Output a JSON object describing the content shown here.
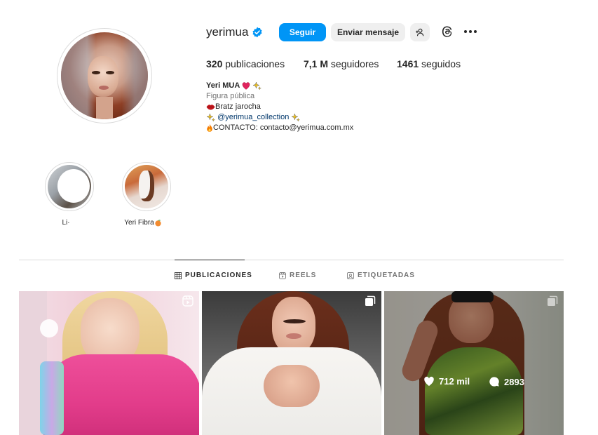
{
  "profile": {
    "username": "yerimua",
    "follow_label": "Seguir",
    "message_label": "Enviar mensaje",
    "stats": {
      "posts_count": "320",
      "posts_label": " publicaciones",
      "followers_count": "7,1 M",
      "followers_label": " seguidores",
      "following_count": "1461",
      "following_label": " seguidos"
    },
    "bio": {
      "name": "Yeri MUA",
      "category": "Figura pública",
      "line1": "Bratz jarocha",
      "line2_link": "@yerimua_collection",
      "line3": "CONTACTO: contacto@yerimua.com.mx"
    }
  },
  "highlights": [
    {
      "label": "Li·"
    },
    {
      "label": "Yeri Fibra"
    }
  ],
  "tabs": [
    {
      "label": "PUBLICACIONES",
      "icon": "grid-icon",
      "active": true
    },
    {
      "label": "REELS",
      "icon": "reels-icon",
      "active": false
    },
    {
      "label": "ETIQUETADAS",
      "icon": "tagged-icon",
      "active": false
    }
  ],
  "posts": [
    {
      "type": "reel-icon"
    },
    {
      "type": "carousel-icon"
    },
    {
      "type": "carousel-icon",
      "likes": "712 mil",
      "comments": "2893"
    }
  ],
  "colors": {
    "accent": "#0095f6",
    "verified": "#0095f6",
    "link": "#00376b"
  }
}
